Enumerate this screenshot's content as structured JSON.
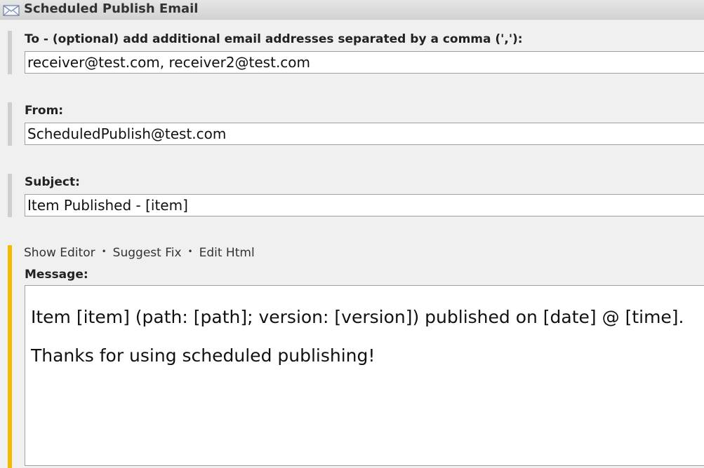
{
  "header": {
    "title": "Scheduled Publish Email",
    "icon": "mail-icon"
  },
  "to": {
    "label": "To - (optional) add additional email addresses separated by a comma (','):",
    "value": "receiver@test.com, receiver2@test.com"
  },
  "from": {
    "label": "From:",
    "value": "ScheduledPublish@test.com"
  },
  "subject": {
    "label": "Subject:",
    "value": "Item Published - [item]"
  },
  "message": {
    "links": [
      "Show Editor",
      "Suggest Fix",
      "Edit Html"
    ],
    "separator": "•",
    "label": "Message:",
    "lines": [
      "Item [item] (path: [path]; version: [version]) published on [date] @ [time].",
      "Thanks for using scheduled publishing!"
    ]
  },
  "colors": {
    "focus_bar": "#f7b800",
    "inactive_bar": "#cfcfcf",
    "background": "#f0f0f0"
  }
}
